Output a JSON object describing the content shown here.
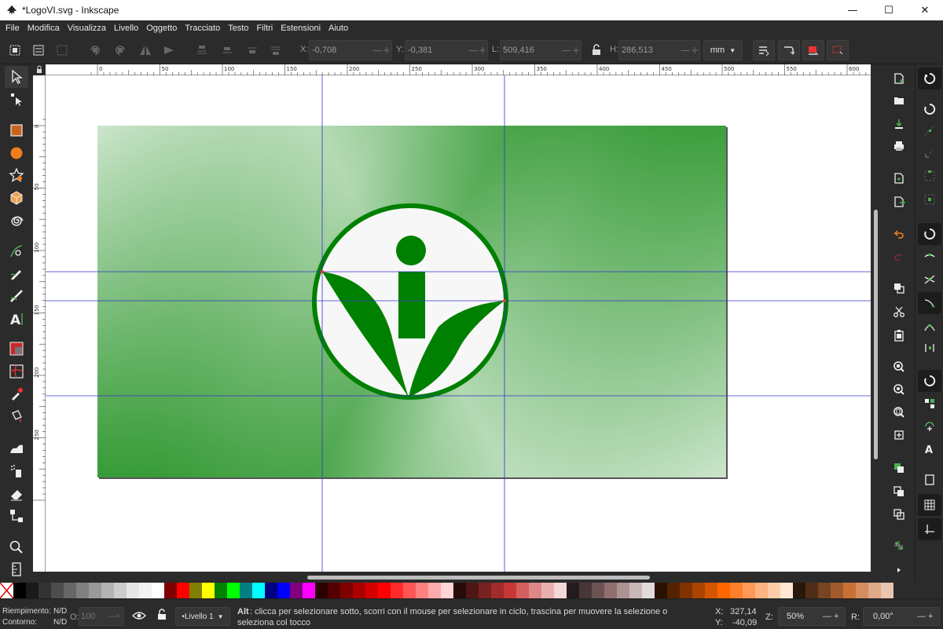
{
  "window": {
    "title": "*LogoVI.svg - Inkscape",
    "minimize": "—",
    "maximize": "☐",
    "close": "✕"
  },
  "menu": [
    "File",
    "Modifica",
    "Visualizza",
    "Livello",
    "Oggetto",
    "Tracciato",
    "Testo",
    "Filtri",
    "Estensioni",
    "Aiuto"
  ],
  "toolcontrols": {
    "x_label": "X:",
    "x_value": "-0,708",
    "y_label": "Y:",
    "y_value": "-0,381",
    "w_label": "L:",
    "w_value": "509,416",
    "h_label": "H:",
    "h_value": "286,513",
    "unit": "mm",
    "minus": "—",
    "plus": "+"
  },
  "ruler": {
    "h_ticks": [
      "0",
      "50",
      "100",
      "150",
      "200",
      "250",
      "300",
      "350",
      "400",
      "450",
      "500",
      "550",
      "600"
    ],
    "v_ticks": [
      "0",
      "50",
      "100",
      "150",
      "200",
      "250"
    ]
  },
  "status": {
    "fill_label": "Riempimento:",
    "fill_value": "N/D",
    "stroke_label": "Contorno:",
    "stroke_value": "N/D",
    "opacity_label": "O:",
    "opacity_value": "100",
    "layer": "•Livello 1",
    "message_key": "Alt",
    "message": ": clicca per selezionare sotto, scorri con il mouse per selezionare in ciclo, trascina per muovere la selezione o",
    "message_line2": "seleziona col tocco",
    "cursor_x_label": "X:",
    "cursor_x": "327,14",
    "cursor_y_label": "Y:",
    "cursor_y": "-40,09",
    "zoom_label": "Z:",
    "zoom": "50%",
    "rotation_label": "R:",
    "rotation": "0,00°"
  },
  "colors": {
    "accent_green": "#008000",
    "guide": "#3333cc",
    "ui_bg": "#2b2b2b"
  },
  "palette": [
    "#000000",
    "#1a1a1a",
    "#333333",
    "#4d4d4d",
    "#666666",
    "#808080",
    "#999999",
    "#b3b3b3",
    "#cccccc",
    "#e6e6e6",
    "#f2f2f2",
    "#ffffff",
    "#800000",
    "#ff0000",
    "#808000",
    "#ffff00",
    "#008000",
    "#00ff00",
    "#008080",
    "#00ffff",
    "#000080",
    "#0000ff",
    "#800080",
    "#ff00ff",
    "#2b0000",
    "#550000",
    "#800000",
    "#aa0000",
    "#d40000",
    "#ff0000",
    "#ff2a2a",
    "#ff5555",
    "#ff8080",
    "#ffaaaa",
    "#ffd5d5",
    "#280b0b",
    "#501616",
    "#782121",
    "#a02c2c",
    "#c83737",
    "#d35f5f",
    "#de8787",
    "#e9afaf",
    "#f4d7d7",
    "#241c1c",
    "#483737",
    "#6c5353",
    "#916f6f",
    "#ac9393",
    "#c8b7b7",
    "#e3dbdb",
    "#2b1100",
    "#552200",
    "#803300",
    "#aa4400",
    "#d45500",
    "#ff6600",
    "#ff7f2a",
    "#ff9955",
    "#ffb380",
    "#ffccaa",
    "#ffe6d5",
    "#28170b",
    "#502d16",
    "#784421",
    "#a05a2c",
    "#c87137",
    "#d38d5f",
    "#deaa87",
    "#e9c6af"
  ]
}
